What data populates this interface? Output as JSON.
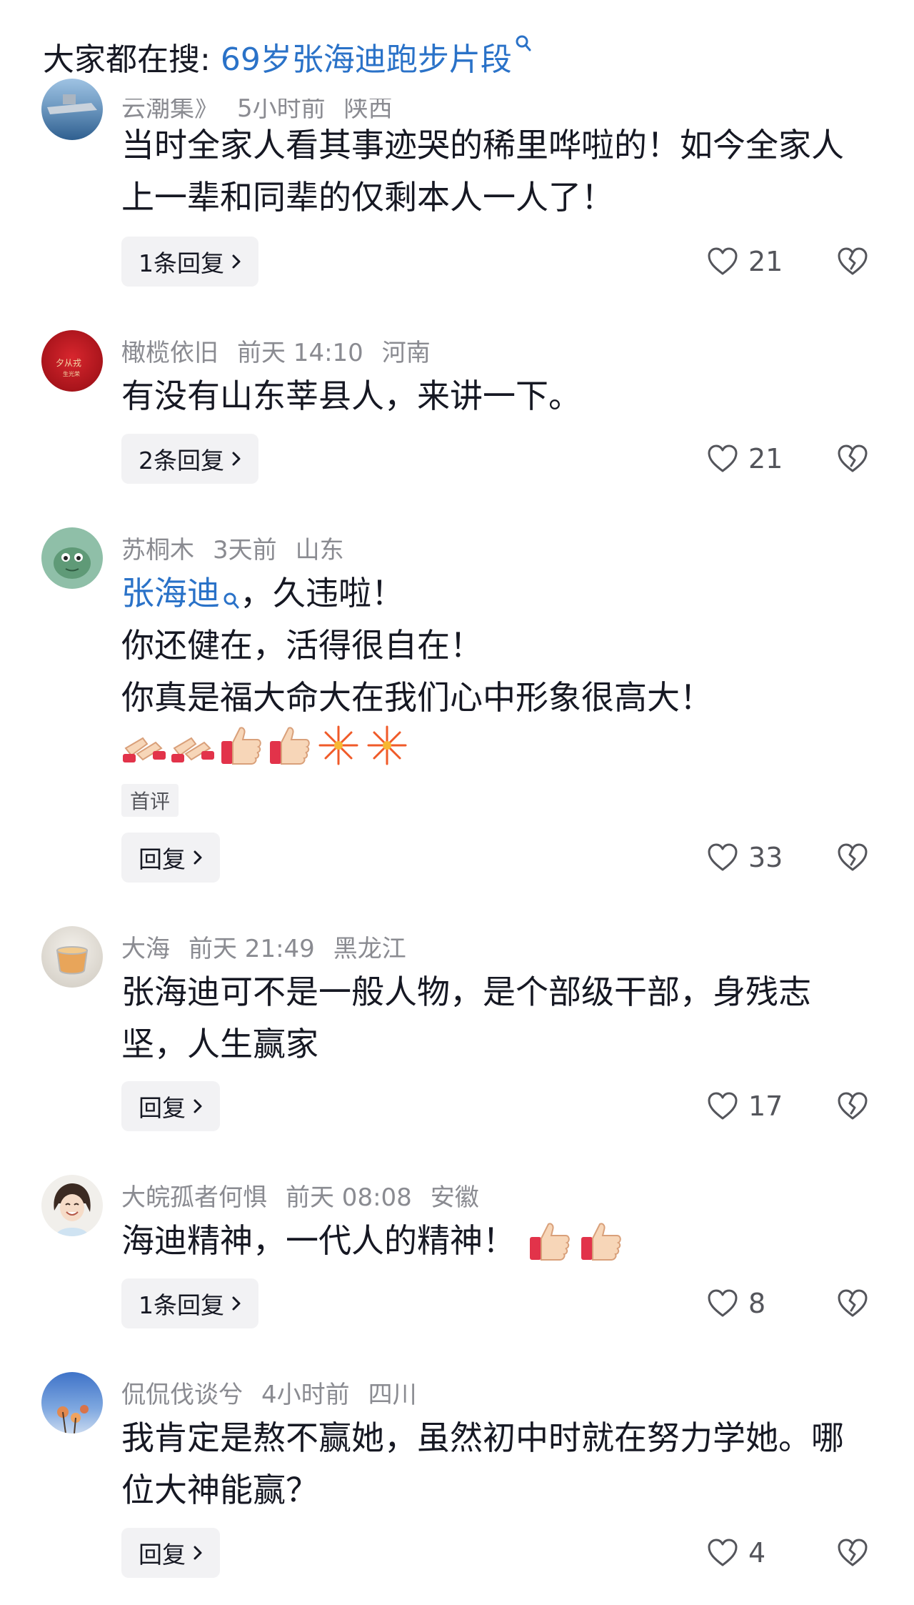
{
  "search": {
    "label": "大家都在搜:",
    "query": "69岁张海迪跑步片段"
  },
  "comments": [
    {
      "author": "云潮集》",
      "time": "5小时前",
      "location": "陕西",
      "lines": [
        "当时全家人看其事迹哭的稀里哗啦的！如今全家人",
        "上一辈和同辈的仅剩本人一人了！"
      ],
      "reply_label": "1条回复",
      "likes": "21"
    },
    {
      "author": "橄榄依旧",
      "time": "前天 14:10",
      "location": "河南",
      "lines": [
        "有没有山东莘县人，来讲一下。"
      ],
      "reply_label": "2条回复",
      "likes": "21"
    },
    {
      "author": "苏桐木",
      "time": "3天前",
      "location": "山东",
      "mention": "张海迪",
      "mention_suffix": "，久违啦！",
      "lines": [
        "你还健在，活得很自在！",
        "你真是福大命大在我们心中形象很高大！"
      ],
      "emojis": [
        "clap",
        "clap",
        "thumbs-up",
        "thumbs-up",
        "fireworks",
        "fireworks"
      ],
      "tag": "首评",
      "reply_label": "回复",
      "likes": "33"
    },
    {
      "author": "大海",
      "time": "前天 21:49",
      "location": "黑龙江",
      "lines": [
        "张海迪可不是一般人物，是个部级干部，身残志",
        "坚，人生赢家"
      ],
      "reply_label": "回复",
      "likes": "17"
    },
    {
      "author": "大皖孤者何惧",
      "time": "前天 08:08",
      "location": "安徽",
      "lines": [
        "海迪精神，一代人的精神！"
      ],
      "emojis": [
        "thumbs-up",
        "thumbs-up"
      ],
      "reply_label": "1条回复",
      "likes": "8"
    },
    {
      "author": "侃侃伐谈兮",
      "time": "4小时前",
      "location": "四川",
      "lines": [
        "我肯定是熬不赢她，虽然初中时就在努力学她。哪",
        "位大神能赢？"
      ],
      "reply_label": "回复",
      "likes": "4"
    }
  ]
}
